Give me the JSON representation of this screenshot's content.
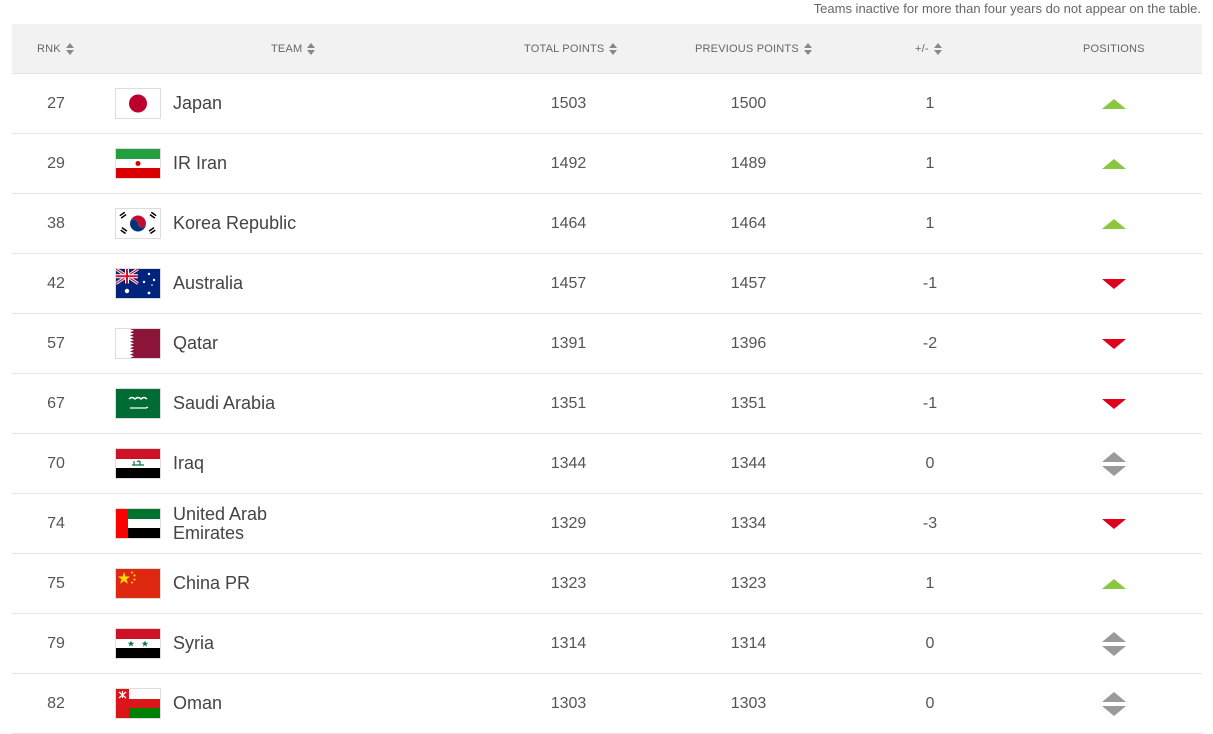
{
  "note": "Teams inactive for more than four years do not appear on the table.",
  "columns": {
    "rank": "RNK",
    "team": "TEAM",
    "total": "TOTAL POINTS",
    "previous": "PREVIOUS POINTS",
    "diff": "+/-",
    "positions": "POSITIONS"
  },
  "colors": {
    "up": "#8cc63f",
    "down": "#e0001b",
    "same": "#9a9a9a"
  },
  "rows": [
    {
      "rank": "27",
      "team": "Japan",
      "flag": "japan-flag-icon",
      "total": "1503",
      "previous": "1500",
      "diff": "1",
      "trend": "up"
    },
    {
      "rank": "29",
      "team": "IR Iran",
      "flag": "iran-flag-icon",
      "total": "1492",
      "previous": "1489",
      "diff": "1",
      "trend": "up"
    },
    {
      "rank": "38",
      "team": "Korea Republic",
      "flag": "korea-flag-icon",
      "total": "1464",
      "previous": "1464",
      "diff": "1",
      "trend": "up"
    },
    {
      "rank": "42",
      "team": "Australia",
      "flag": "australia-flag-icon",
      "total": "1457",
      "previous": "1457",
      "diff": "-1",
      "trend": "down"
    },
    {
      "rank": "57",
      "team": "Qatar",
      "flag": "qatar-flag-icon",
      "total": "1391",
      "previous": "1396",
      "diff": "-2",
      "trend": "down"
    },
    {
      "rank": "67",
      "team": "Saudi Arabia",
      "flag": "saudi-arabia-flag-icon",
      "total": "1351",
      "previous": "1351",
      "diff": "-1",
      "trend": "down"
    },
    {
      "rank": "70",
      "team": "Iraq",
      "flag": "iraq-flag-icon",
      "total": "1344",
      "previous": "1344",
      "diff": "0",
      "trend": "same"
    },
    {
      "rank": "74",
      "team": "United Arab Emirates",
      "flag": "uae-flag-icon",
      "total": "1329",
      "previous": "1334",
      "diff": "-3",
      "trend": "down"
    },
    {
      "rank": "75",
      "team": "China PR",
      "flag": "china-flag-icon",
      "total": "1323",
      "previous": "1323",
      "diff": "1",
      "trend": "up"
    },
    {
      "rank": "79",
      "team": "Syria",
      "flag": "syria-flag-icon",
      "total": "1314",
      "previous": "1314",
      "diff": "0",
      "trend": "same"
    },
    {
      "rank": "82",
      "team": "Oman",
      "flag": "oman-flag-icon",
      "total": "1303",
      "previous": "1303",
      "diff": "0",
      "trend": "same"
    }
  ]
}
